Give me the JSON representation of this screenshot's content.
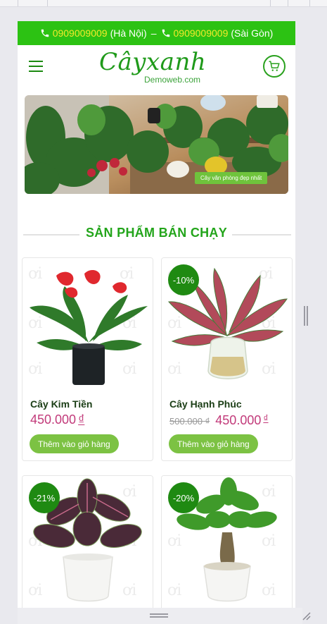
{
  "topbar": {
    "phone1": "0909009009",
    "city1": "(Hà Nội)",
    "separator": "–",
    "phone2": "0909009009",
    "city2": "(Sài Gòn)"
  },
  "header": {
    "logo_title": "Câyxanh",
    "logo_subtitle": "Demoweb.com",
    "menu_icon": "hamburger-icon",
    "cart_icon": "cart-icon"
  },
  "banner": {
    "caption": "Cây văn phòng đẹp nhất"
  },
  "section": {
    "title": "SẢN PHẨM BÁN CHẠY"
  },
  "products": [
    {
      "name": "Cây Kim Tiền",
      "old_price": "",
      "price": "450.000",
      "currency": "₫",
      "discount": "",
      "button": "Thêm vào giỏ hàng"
    },
    {
      "name": "Cây Hạnh Phúc",
      "old_price": "500.000 ₫",
      "price": "450.000",
      "currency": "₫",
      "discount": "-10%",
      "button": "Thêm vào giỏ hàng"
    },
    {
      "name": "",
      "old_price": "",
      "price": "",
      "currency": "",
      "discount": "-21%",
      "button": ""
    },
    {
      "name": "",
      "old_price": "",
      "price": "",
      "currency": "",
      "discount": "-20%",
      "button": ""
    }
  ],
  "colors": {
    "topbar": "#2cc213",
    "phone_number": "#f3ea2b",
    "brand_green": "#23a51b",
    "badge": "#1f8a12",
    "price": "#c23a7a",
    "button": "#7cc243"
  }
}
